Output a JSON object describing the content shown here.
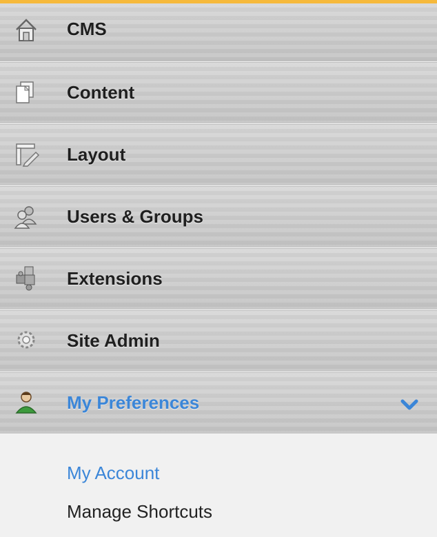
{
  "nav": {
    "items": [
      {
        "label": "CMS",
        "icon": "house-icon"
      },
      {
        "label": "Content",
        "icon": "documents-icon"
      },
      {
        "label": "Layout",
        "icon": "layout-icon"
      },
      {
        "label": "Users & Groups",
        "icon": "users-icon"
      },
      {
        "label": "Extensions",
        "icon": "puzzle-icon"
      },
      {
        "label": "Site Admin",
        "icon": "gear-icon"
      },
      {
        "label": "My Preferences",
        "icon": "user-icon",
        "active": true
      }
    ],
    "submenu": [
      {
        "label": "My Account",
        "active": true
      },
      {
        "label": "Manage Shortcuts"
      }
    ]
  },
  "colors": {
    "accent": "#3b86d8",
    "top_bar": "#f6b93b",
    "user_icon_green": "#3c9a3c"
  }
}
